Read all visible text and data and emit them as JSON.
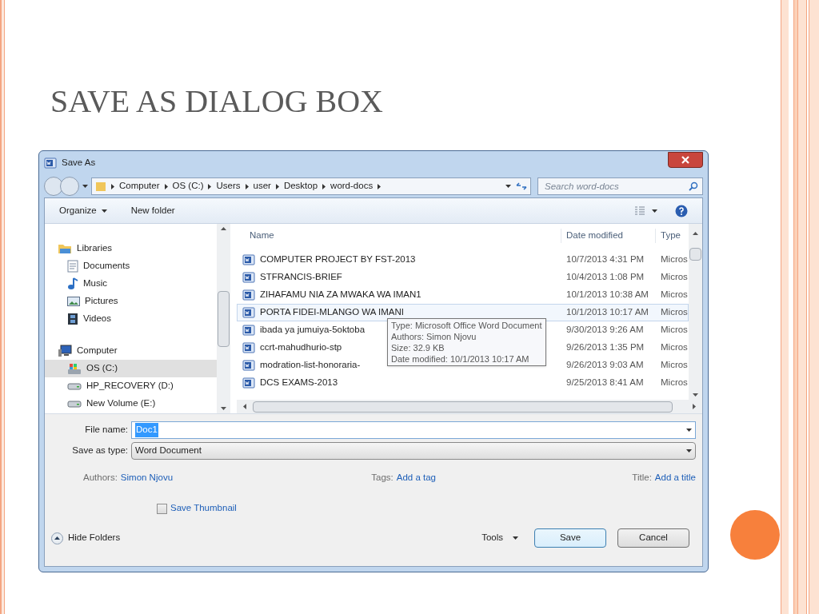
{
  "slide_title": "SAVE AS DIALOG BOX",
  "window": {
    "title": "Save As"
  },
  "breadcrumb": [
    "Computer",
    "OS (C:)",
    "Users",
    "user",
    "Desktop",
    "word-docs"
  ],
  "search": {
    "placeholder": "Search word-docs"
  },
  "toolbar": [
    "Organize",
    "New folder"
  ],
  "nav": [
    {
      "label": "Libraries",
      "kind": "library",
      "selected": false,
      "children": [
        {
          "label": "Documents",
          "kind": "documents",
          "selected": false
        },
        {
          "label": "Music",
          "kind": "music",
          "selected": false
        },
        {
          "label": "Pictures",
          "kind": "pictures",
          "selected": false
        },
        {
          "label": "Videos",
          "kind": "videos",
          "selected": false
        }
      ]
    },
    {
      "label": "Computer",
      "kind": "computer",
      "selected": false,
      "children": [
        {
          "label": "OS (C:)",
          "kind": "osdrive",
          "selected": true
        },
        {
          "label": "HP_RECOVERY (D:)",
          "kind": "drive",
          "selected": false
        },
        {
          "label": "New Volume (E:)",
          "kind": "drive",
          "selected": false
        }
      ]
    }
  ],
  "columns": [
    "Name",
    "Date modified",
    "Type"
  ],
  "rows": [
    {
      "name": "COMPUTER PROJECT BY FST-2013",
      "date": "10/7/2013 4:31 PM",
      "type": "Micros",
      "selected": false
    },
    {
      "name": "STFRANCIS-BRIEF",
      "date": "10/4/2013 1:08 PM",
      "type": "Micros",
      "selected": false
    },
    {
      "name": "ZIHAFAMU NIA ZA MWAKA WA IMAN1",
      "date": "10/1/2013 10:38 AM",
      "type": "Micros",
      "selected": false
    },
    {
      "name": "PORTA FIDEI-MLANGO WA IMANI",
      "date": "10/1/2013 10:17 AM",
      "type": "Micros",
      "selected": true
    },
    {
      "name": "ibada ya jumuiya-5oktoba",
      "date": "9/30/2013 9:26 AM",
      "type": "Micros",
      "selected": false
    },
    {
      "name": "ccrt-mahudhurio-stp",
      "date": "9/26/2013 1:35 PM",
      "type": "Micros",
      "selected": false
    },
    {
      "name": "modration-list-honoraria-",
      "date": "9/26/2013 9:03 AM",
      "type": "Micros",
      "selected": false
    },
    {
      "name": "DCS EXAMS-2013",
      "date": "9/25/2013 8:41 AM",
      "type": "Micros",
      "selected": false
    }
  ],
  "tooltip": [
    "Type: Microsoft Office Word Document",
    "Authors: Simon Njovu",
    "Size: 32.9 KB",
    "Date modified: 10/1/2013 10:17 AM"
  ],
  "file_name": {
    "label": "File name:",
    "value": "Doc1"
  },
  "save_as_type": {
    "label": "Save as type:",
    "value": "Word Document"
  },
  "meta": [
    {
      "label": "Authors:",
      "value": "Simon Njovu"
    },
    {
      "label": "Tags:",
      "value": "Add a tag"
    },
    {
      "label": "Title:",
      "value": "Add a title"
    }
  ],
  "save_thumbnail": {
    "label": "Save Thumbnail",
    "checked": false
  },
  "hide_folders": "Hide Folders",
  "tools": "Tools",
  "buttons": [
    "Save",
    "Cancel"
  ]
}
